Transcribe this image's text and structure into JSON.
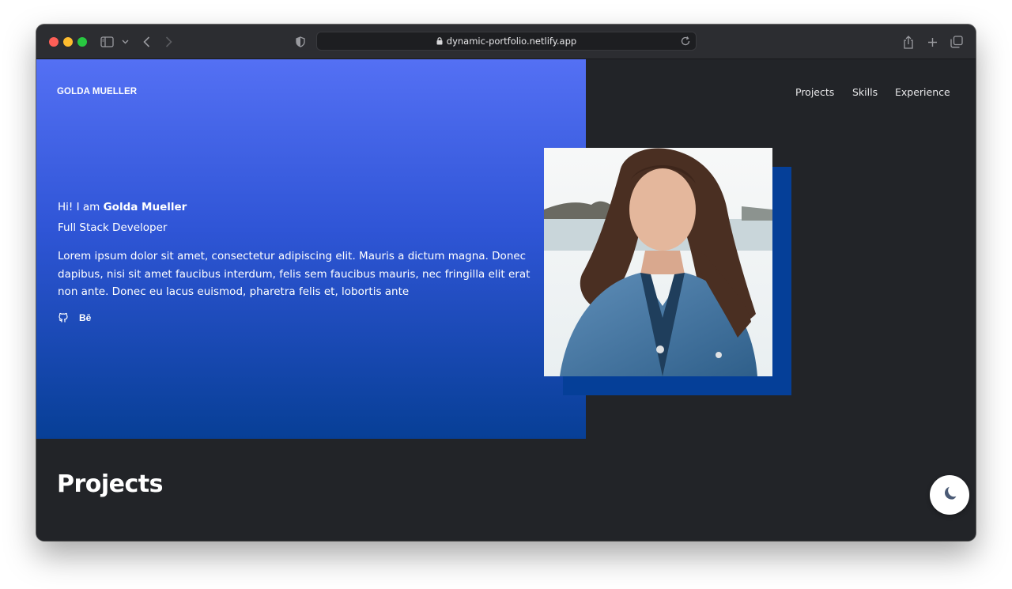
{
  "browser": {
    "url": "dynamic-portfolio.netlify.app"
  },
  "header": {
    "brand": "GOLDA MUELLER",
    "nav": [
      {
        "label": "Projects"
      },
      {
        "label": "Skills"
      },
      {
        "label": "Experience"
      }
    ]
  },
  "hero": {
    "greeting_prefix": "Hi! I am ",
    "name": "Golda Mueller",
    "role": "Full Stack Developer",
    "bio": "Lorem ipsum dolor sit amet, consectetur adipiscing elit. Mauris a dictum magna. Donec dapibus, nisi sit amet faucibus interdum, felis sem faucibus mauris, nec fringilla elit erat non ante. Donec eu lacus euismod, pharetra felis et, lobortis ante",
    "social": {
      "github_icon": "github-icon",
      "behance_label": "Bē"
    }
  },
  "sections": {
    "projects_title": "Projects"
  },
  "colors": {
    "accent": "#2f55d6",
    "accent_dark": "#053f98",
    "background": "#222428"
  }
}
